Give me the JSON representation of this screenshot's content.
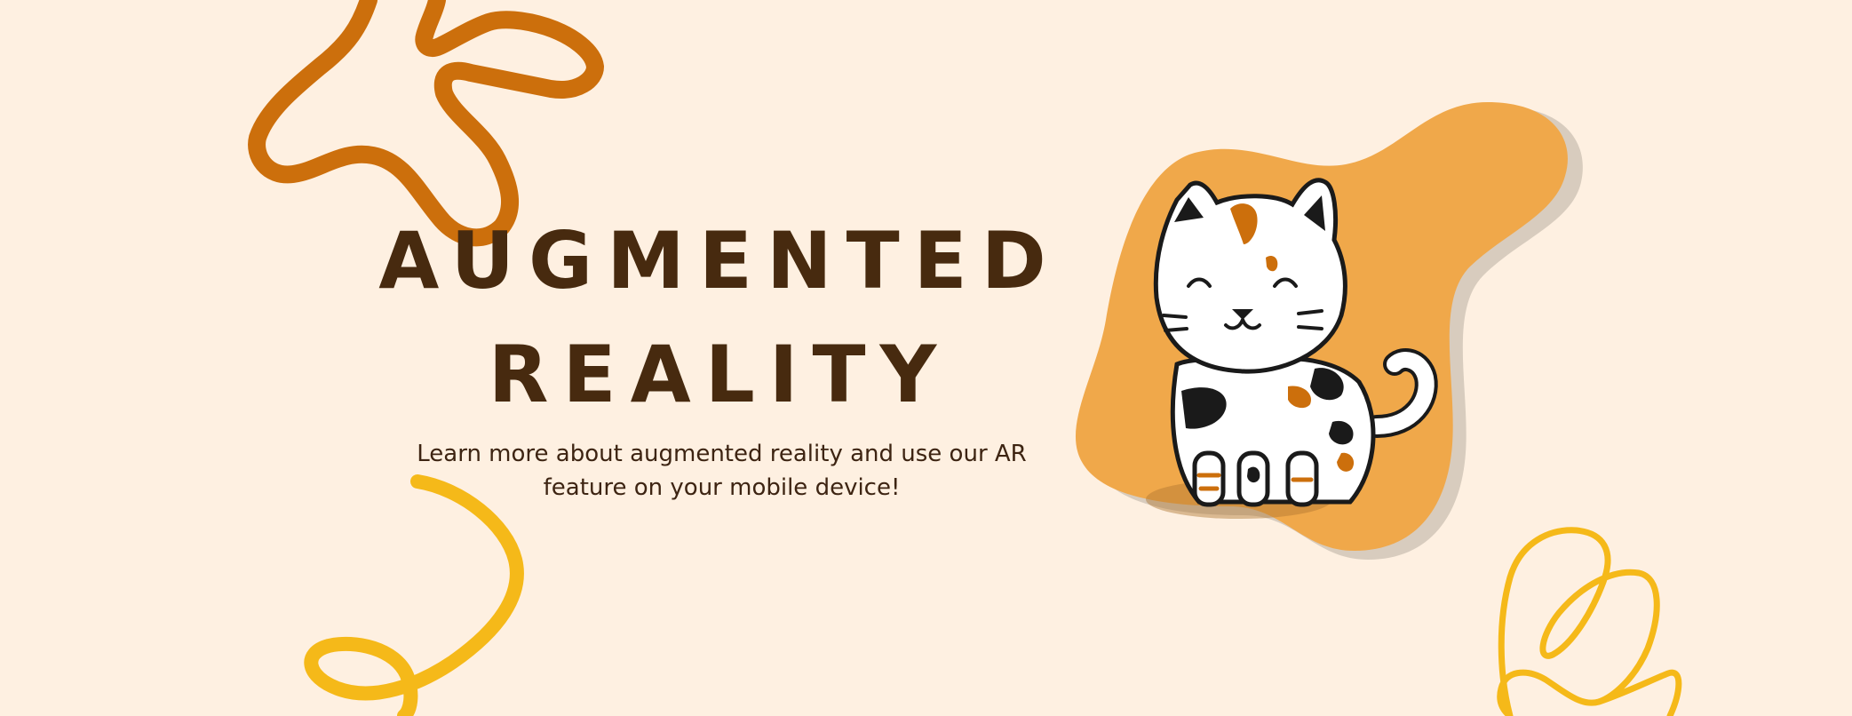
{
  "hero": {
    "title_line1": "AUGMENTED",
    "title_line2": "REALITY",
    "subtitle": "Learn more about augmented reality and use our AR feature on your mobile device!"
  },
  "decorations": {
    "top_left": "orange-squiggle",
    "bottom_left": "yellow-swirl",
    "bottom_right": "yellow-scribble",
    "illustration": "calico-cat"
  },
  "colors": {
    "background": "#fef0e1",
    "title": "#472a0f",
    "accent_orange": "#cc6f0c",
    "accent_yellow": "#f5b919",
    "blob": "#f0a84a",
    "blob_shadow": "#d8ccbe"
  }
}
